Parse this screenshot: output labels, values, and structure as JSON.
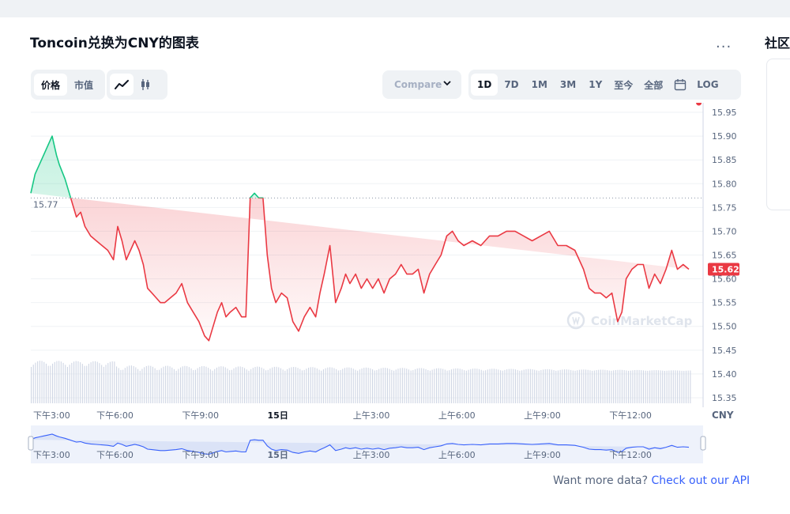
{
  "title": "Toncoin兑换为CNY的图表",
  "more_label": "...",
  "side_title": "社区",
  "toggles": {
    "price": "价格",
    "market_cap": "市值"
  },
  "chart_style_icons": [
    "line-chart-icon",
    "candlestick-icon"
  ],
  "compare_placeholder": "Compare",
  "ranges": [
    "1D",
    "7D",
    "1M",
    "3M",
    "1Y",
    "至今",
    "全部"
  ],
  "active_range": "1D",
  "log_label": "LOG",
  "footer": {
    "question": "Want more data?",
    "link": "Check out our API"
  },
  "watermark": "CoinMarketCap",
  "colors": {
    "up": "#16c784",
    "down": "#ea3943",
    "navigator_fill": "#dbe3f7",
    "navigator_line": "#3861fb",
    "volume": "#cfd6e4"
  },
  "chart_data": {
    "type": "area",
    "currency_label": "CNY",
    "ylim": [
      15.33,
      15.97
    ],
    "yticks": [
      15.35,
      15.4,
      15.45,
      15.5,
      15.55,
      15.6,
      15.65,
      15.7,
      15.75,
      15.8,
      15.85,
      15.9,
      15.95
    ],
    "reference_price": 15.77,
    "reference_label": "15.77",
    "current_price": 15.62,
    "current_label": "15.62",
    "x_range_hours": [
      0,
      23.6
    ],
    "xtick_labels": [
      {
        "hours": 0,
        "label": "下午3:00"
      },
      {
        "hours": 3,
        "label": "下午6:00"
      },
      {
        "hours": 6,
        "label": "下午9:00"
      },
      {
        "hours": 9,
        "label": "15日"
      },
      {
        "hours": 12,
        "label": "上午3:00"
      },
      {
        "hours": 15,
        "label": "上午6:00"
      },
      {
        "hours": 18,
        "label": "上午9:00"
      },
      {
        "hours": 21,
        "label": "下午12:00"
      }
    ],
    "x": [
      0,
      0.15,
      0.3,
      0.45,
      0.6,
      0.75,
      0.9,
      1.0,
      1.2,
      1.4,
      1.6,
      1.75,
      1.9,
      2.1,
      2.3,
      2.5,
      2.7,
      2.9,
      3.05,
      3.2,
      3.35,
      3.5,
      3.65,
      3.8,
      3.95,
      4.1,
      4.25,
      4.4,
      4.55,
      4.7,
      4.9,
      5.1,
      5.3,
      5.5,
      5.7,
      5.9,
      6.1,
      6.25,
      6.4,
      6.55,
      6.7,
      6.85,
      7.0,
      7.2,
      7.4,
      7.55,
      7.7,
      7.85,
      8.0,
      8.15,
      8.3,
      8.45,
      8.6,
      8.8,
      9.0,
      9.2,
      9.4,
      9.6,
      9.8,
      10.0,
      10.15,
      10.3,
      10.5,
      10.7,
      10.9,
      11.05,
      11.2,
      11.4,
      11.6,
      11.8,
      12.0,
      12.2,
      12.4,
      12.6,
      12.8,
      13.0,
      13.2,
      13.4,
      13.6,
      13.8,
      14.0,
      14.2,
      14.4,
      14.6,
      14.8,
      15.0,
      15.2,
      15.5,
      15.8,
      16.1,
      16.4,
      16.7,
      17.0,
      17.3,
      17.6,
      17.9,
      18.2,
      18.5,
      18.8,
      19.1,
      19.4,
      19.6,
      19.8,
      20.0,
      20.2,
      20.4,
      20.6,
      20.75,
      20.9,
      21.1,
      21.3,
      21.5,
      21.7,
      21.9,
      22.1,
      22.3,
      22.5,
      22.7,
      22.9,
      23.1,
      23.3,
      23.45
    ],
    "values": [
      15.78,
      15.82,
      15.84,
      15.86,
      15.88,
      15.9,
      15.86,
      15.84,
      15.81,
      15.77,
      15.73,
      15.74,
      15.71,
      15.69,
      15.68,
      15.67,
      15.66,
      15.64,
      15.71,
      15.68,
      15.64,
      15.66,
      15.68,
      15.66,
      15.63,
      15.58,
      15.57,
      15.56,
      15.55,
      15.55,
      15.56,
      15.57,
      15.59,
      15.55,
      15.53,
      15.51,
      15.48,
      15.47,
      15.5,
      15.53,
      15.55,
      15.52,
      15.53,
      15.54,
      15.52,
      15.52,
      15.77,
      15.78,
      15.77,
      15.77,
      15.65,
      15.58,
      15.55,
      15.57,
      15.56,
      15.51,
      15.49,
      15.52,
      15.54,
      15.52,
      15.57,
      15.61,
      15.67,
      15.55,
      15.58,
      15.61,
      15.59,
      15.61,
      15.58,
      15.6,
      15.58,
      15.6,
      15.57,
      15.6,
      15.61,
      15.63,
      15.61,
      15.61,
      15.62,
      15.57,
      15.61,
      15.63,
      15.65,
      15.69,
      15.7,
      15.68,
      15.67,
      15.68,
      15.67,
      15.69,
      15.69,
      15.7,
      15.7,
      15.69,
      15.68,
      15.69,
      15.7,
      15.67,
      15.67,
      15.66,
      15.62,
      15.58,
      15.57,
      15.57,
      15.56,
      15.57,
      15.51,
      15.53,
      15.6,
      15.62,
      15.63,
      15.63,
      15.58,
      15.61,
      15.59,
      15.62,
      15.66,
      15.62,
      15.63,
      15.62
    ]
  }
}
